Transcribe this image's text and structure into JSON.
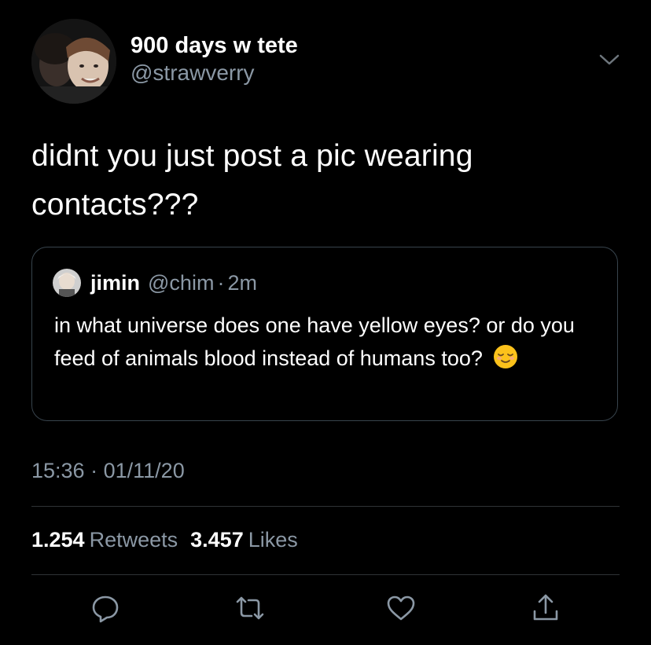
{
  "author": {
    "display_name": "900 days w tete",
    "handle": "@strawverry",
    "avatar_icon": "profile-photo"
  },
  "tweet": {
    "text_line1": "didnt you just post a pic wearing",
    "text_line2": "contacts???"
  },
  "quoted_tweet": {
    "name": "jimin",
    "handle": "@chim",
    "separator": "·",
    "time": "2m",
    "text": "in what universe does one have yellow eyes? or do you feed of animals blood instead of humans too?",
    "emoji": "relieved-face"
  },
  "timestamp": {
    "time": "15:36",
    "separator": "·",
    "date": "01/11/20"
  },
  "stats": {
    "retweets_count": "1.254",
    "retweets_label": "Retweets",
    "likes_count": "3.457",
    "likes_label": "Likes"
  },
  "actions": [
    "reply-icon",
    "retweet-icon",
    "like-icon",
    "share-icon"
  ],
  "colors": {
    "background": "#000000",
    "text_primary": "#ffffff",
    "text_secondary": "#8b98a5",
    "border": "#38444d",
    "divider": "#2f3336"
  }
}
